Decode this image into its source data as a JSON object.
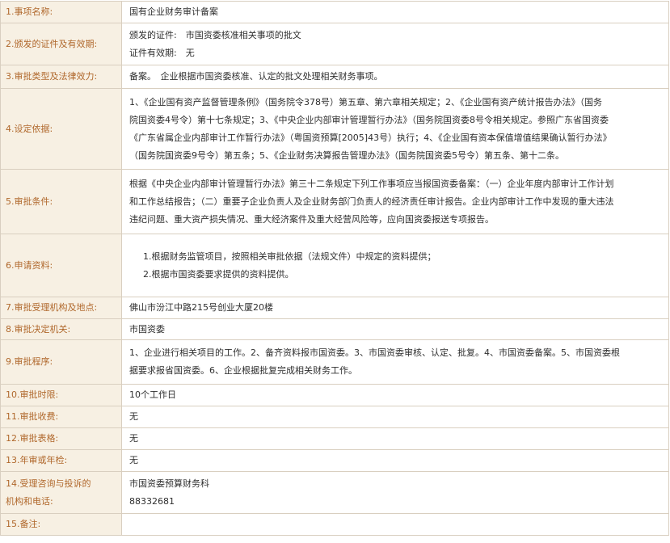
{
  "rows": [
    {
      "label": "1.事项名称:",
      "lines": [
        "国有企业财务审计备案"
      ]
    },
    {
      "label": "2.颁发的证件及有效期:",
      "lines": [
        "颁发的证件:　市国资委核准相关事项的批文",
        "证件有效期:　无"
      ]
    },
    {
      "label": "3.审批类型及法律效力:",
      "lines": [
        "备案。　企业根据市国资委核准、认定的批文处理相关财务事项。"
      ]
    },
    {
      "label": "4.设定依据:",
      "lines": [
        "1、《企业国有资产监督管理条例》（国务院令378号）第五章、第六章相关规定；2、《企业国有资产统计报告办法》（国务",
        "院国资委4号令）第十七条规定；3、《中央企业内部审计管理暂行办法》（国务院国资委8号令相关规定。参照广东省国资委",
        "《广东省属企业内部审计工作暂行办法》（粤国资预算[2005]43号）执行；4、《企业国有资本保值增值结果确认暂行办法》",
        "（国务院国资委9号令）第五条；5、《企业财务决算报告管理办法》（国务院国资委5号令）第五条、第十二条。"
      ]
    },
    {
      "label": "5.审批条件:",
      "lines": [
        "根据《中央企业内部审计管理暂行办法》第三十二条规定下列工作事项应当报国资委备案：（一）企业年度内部审计工作计划",
        "和工作总结报告；（二）重要子企业负责人及企业财务部门负责人的经济责任审计报告。企业内部审计工作中发现的重大违法",
        "违纪问题、重大资产损失情况、重大经济案件及重大经营风险等，应向国资委报送专项报告。"
      ]
    },
    {
      "label": "6.申请资料:",
      "lines": [
        "1.根据财务监管项目，按照相关审批依据（法规文件）中规定的资料提供；",
        "2.根据市国资委要求提供的资料提供。"
      ]
    },
    {
      "label": "7.审批受理机构及地点:",
      "lines": [
        "佛山市汾江中路215号创业大厦20楼"
      ]
    },
    {
      "label": "8.审批决定机关:",
      "lines": [
        "市国资委"
      ]
    },
    {
      "label": "9.审批程序:",
      "lines": [
        "1、企业进行相关项目的工作。2、备齐资料报市国资委。3、市国资委审核、认定、批复。4、市国资委备案。5、市国资委根",
        "据要求报省国资委。6、企业根据批复完成相关财务工作。"
      ]
    },
    {
      "label": "10.审批时限:",
      "lines": [
        "10个工作日"
      ]
    },
    {
      "label": "11.审批收费:",
      "lines": [
        "无"
      ]
    },
    {
      "label": "12.审批表格:",
      "lines": [
        "无"
      ]
    },
    {
      "label": "13.年审或年检:",
      "lines": [
        "无"
      ]
    },
    {
      "label_lines": [
        "14.受理咨询与投诉的",
        "机构和电话:"
      ],
      "lines": [
        "市国资委预算财务科",
        "88332681"
      ]
    },
    {
      "label": "15.备注:",
      "lines": []
    }
  ]
}
